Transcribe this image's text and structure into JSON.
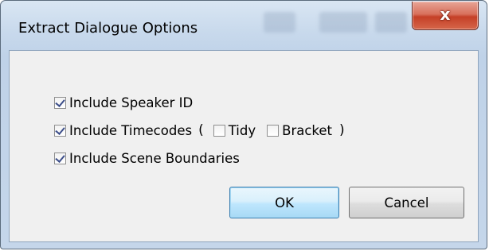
{
  "window": {
    "title": "Extract Dialogue Options",
    "close_glyph": "x",
    "close_icon": "close-icon"
  },
  "options": {
    "speaker_id": {
      "label": "Include Speaker ID",
      "checked": true
    },
    "timecodes": {
      "label": "Include Timecodes",
      "checked": true,
      "open_paren": "(",
      "close_paren": ")",
      "tidy": {
        "label": "Tidy",
        "checked": false
      },
      "bracket": {
        "label": "Bracket",
        "checked": false
      }
    },
    "scene_boundaries": {
      "label": "Include Scene Boundaries",
      "checked": true
    }
  },
  "buttons": {
    "ok": "OK",
    "cancel": "Cancel"
  },
  "colors": {
    "close_button": "#c54027",
    "default_button_border": "#3c7fb1",
    "checkmark": "#3d4f8a"
  }
}
